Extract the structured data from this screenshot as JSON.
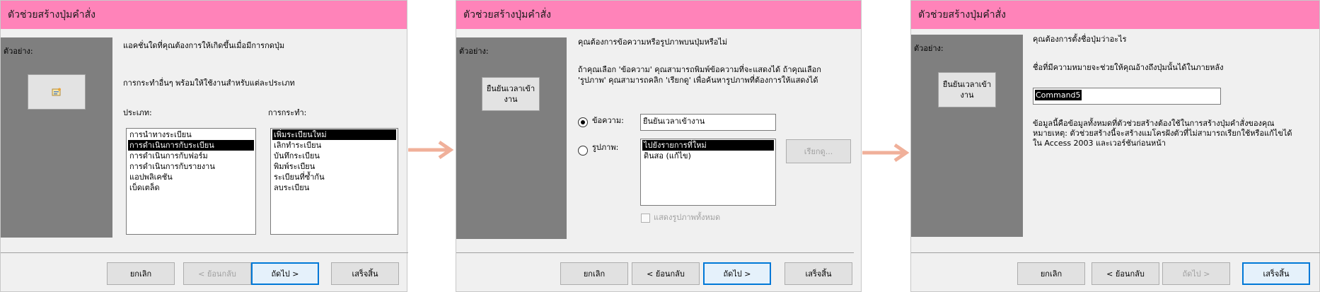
{
  "dialogs": [
    {
      "title": "ตัวช่วยสร้างปุ่มคำสั่ง",
      "preview_label": "ตัวอย่าง:",
      "prompt": "แอคชั่นใดที่คุณต้องการให้เกิดขึ้นเมื่อมีการกดปุ่ม",
      "subprompt": "การกระทำอื่นๆ พร้อมให้ใช้งานสำหรับแต่ละประเภท",
      "categories_label": "ประเภท:",
      "actions_label": "การกระทำ:",
      "categories": [
        "การนำทางระเบียน",
        "การดำเนินการกับระเบียน",
        "การดำเนินการกับฟอร์ม",
        "การดำเนินการกับรายงาน",
        "แอปพลิเคชัน",
        "เบ็ดเตล็ด"
      ],
      "selected_category": 1,
      "actions": [
        "เพิ่มระเบียนใหม่",
        "เลิกทำระเบียน",
        "บันทึกระเบียน",
        "พิมพ์ระเบียน",
        "ระเบียนที่ซ้ำกัน",
        "ลบระเบียน"
      ],
      "selected_action": 0,
      "buttons": {
        "cancel": "ยกเลิก",
        "back": "< ย้อนกลับ",
        "next": "ถัดไป >",
        "finish": "เสร็จสิ้น"
      }
    },
    {
      "title": "ตัวช่วยสร้างปุ่มคำสั่ง",
      "preview_label": "ตัวอย่าง:",
      "preview_button": "ยืนยันเวลาเข้างาน",
      "prompt": "คุณต้องการข้อความหรือรูปภาพบนปุ่มหรือไม่",
      "desc_line1": "ถ้าคุณเลือก 'ข้อความ' คุณสามารถพิมพ์ข้อความที่จะแสดงได้ ถ้าคุณเลือก",
      "desc_line2": "'รูปภาพ' คุณสามารถคลิก 'เรียกดู' เพื่อค้นหารูปภาพที่ต้องการให้แสดงได้",
      "text_option": "ข้อความ:",
      "text_value": "ยืนยันเวลาเข้างาน",
      "picture_option": "รูปภาพ:",
      "pictures": [
        "ไปยังรายการที่ใหม่",
        "ดินสอ (แก้ไข)"
      ],
      "browse": "เรียกดู...",
      "show_all": "แสดงรูปภาพทั้งหมด",
      "buttons": {
        "cancel": "ยกเลิก",
        "back": "< ย้อนกลับ",
        "next": "ถัดไป >",
        "finish": "เสร็จสิ้น"
      }
    },
    {
      "title": "ตัวช่วยสร้างปุ่มคำสั่ง",
      "preview_label": "ตัวอย่าง:",
      "preview_button": "ยืนยันเวลาเข้างาน",
      "prompt": "คุณต้องการตั้งชื่อปุ่มว่าอะไร",
      "name_hint": "ชื่อที่มีความหมายจะช่วยให้คุณอ้างถึงปุ่มนั้นได้ในภายหลัง",
      "name_value": "Command5",
      "info_line1": "ข้อมูลนี้คือข้อมูลทั้งหมดที่ตัวช่วยสร้างต้องใช้ในการสร้างปุ่มคำสั่งของคุณ",
      "info_line2": "หมายเหตุ: ตัวช่วยสร้างนี้จะสร้างแมโครฝังตัวที่ไม่สามารถเรียกใช้หรือแก้ไขได้",
      "info_line3": "ใน Access 2003 และเวอร์ชันก่อนหน้า",
      "buttons": {
        "cancel": "ยกเลิก",
        "back": "< ย้อนกลับ",
        "next": "ถัดไป >",
        "finish": "เสร็จสิ้น"
      }
    }
  ],
  "colors": {
    "titlebar": "#ff83b9",
    "arrow": "#f0b09a",
    "focus": "#0078d7"
  }
}
